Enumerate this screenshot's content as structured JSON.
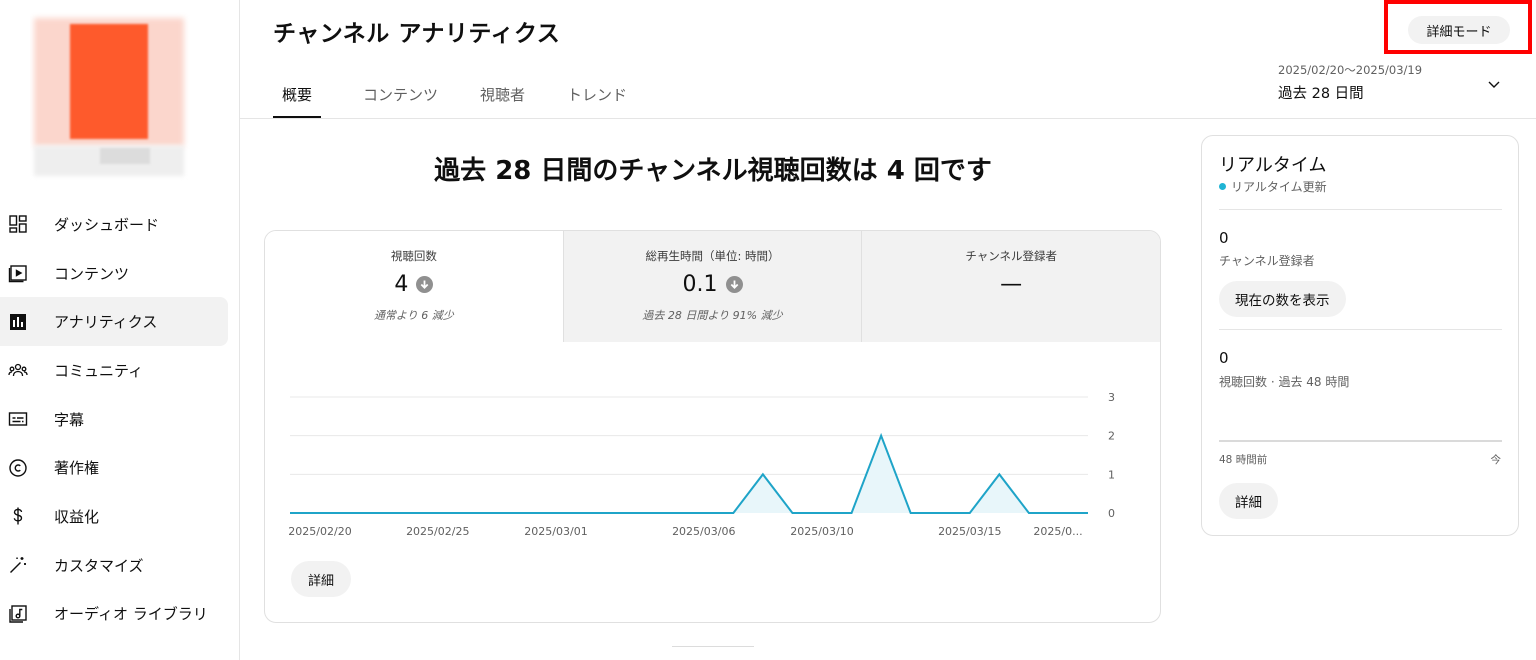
{
  "header": {
    "title": "チャンネル アナリティクス",
    "detail_mode_label": "詳細モード"
  },
  "tabs": [
    {
      "label": "概要"
    },
    {
      "label": "コンテンツ"
    },
    {
      "label": "視聴者"
    },
    {
      "label": "トレンド"
    }
  ],
  "date_range": {
    "dates": "2025/02/20〜2025/03/19",
    "label": "過去 28 日間"
  },
  "sidebar": {
    "items": [
      {
        "label": "ダッシュボード",
        "icon": "dashboard-icon"
      },
      {
        "label": "コンテンツ",
        "icon": "content-icon"
      },
      {
        "label": "アナリティクス",
        "icon": "analytics-icon",
        "active": true
      },
      {
        "label": "コミュニティ",
        "icon": "community-icon"
      },
      {
        "label": "字幕",
        "icon": "subtitles-icon"
      },
      {
        "label": "著作権",
        "icon": "copyright-icon"
      },
      {
        "label": "収益化",
        "icon": "dollar-icon"
      },
      {
        "label": "カスタマイズ",
        "icon": "magic-wand-icon"
      },
      {
        "label": "オーディオ ライブラリ",
        "icon": "audio-library-icon"
      }
    ]
  },
  "headline": "過去 28 日間のチャンネル視聴回数は 4 回です",
  "metrics": [
    {
      "title": "視聴回数",
      "value": "4",
      "note": "通常より 6 減少"
    },
    {
      "title": "総再生時間（単位: 時間）",
      "value": "0.1",
      "note": "過去 28 日間より 91% 減少"
    },
    {
      "title": "チャンネル登録者",
      "value": "—",
      "note": ""
    }
  ],
  "main_detail_label": "詳細",
  "realtime": {
    "title": "リアルタイム",
    "subtitle": "リアルタイム更新",
    "subscribers_value": "0",
    "subscribers_label": "チャンネル登録者",
    "show_count_label": "現在の数を表示",
    "views_value": "0",
    "views_label": "視聴回数 · 過去 48 時間",
    "axis_left": "48 時間前",
    "axis_right": "今",
    "detail_label": "詳細"
  },
  "colors": {
    "accent_line": "#1fa4c8",
    "accent_fill": "#e8f6fa",
    "highlight_box": "#ff0000",
    "realtime_dot": "#1fb4d4"
  },
  "chart_data": {
    "type": "area",
    "x": [
      "2025/02/20",
      "2025/02/21",
      "2025/02/22",
      "2025/02/23",
      "2025/02/24",
      "2025/02/25",
      "2025/02/26",
      "2025/02/27",
      "2025/02/28",
      "2025/03/01",
      "2025/03/02",
      "2025/03/03",
      "2025/03/04",
      "2025/03/05",
      "2025/03/06",
      "2025/03/07",
      "2025/03/08",
      "2025/03/09",
      "2025/03/10",
      "2025/03/11",
      "2025/03/12",
      "2025/03/13",
      "2025/03/14",
      "2025/03/15",
      "2025/03/16",
      "2025/03/17",
      "2025/03/18",
      "2025/03/19"
    ],
    "tick_labels": [
      "2025/02/20",
      "2025/02/25",
      "2025/03/01",
      "2025/03/06",
      "2025/03/10",
      "2025/03/15",
      "2025/03/19"
    ],
    "tick_display": [
      "2025/02/20",
      "2025/02/25",
      "2025/03/01",
      "2025/03/06",
      "2025/03/10",
      "2025/03/15",
      "2025/0..."
    ],
    "series": [
      {
        "values": [
          0,
          0,
          0,
          0,
          0,
          0,
          0,
          0,
          0,
          0,
          0,
          0,
          0,
          0,
          0,
          0,
          1,
          0,
          0,
          0,
          2,
          0,
          0,
          0,
          1,
          0,
          0,
          0
        ]
      }
    ],
    "ylim": [
      0,
      3
    ],
    "yticks": [
      0,
      1,
      2,
      3
    ],
    "grid": true,
    "y_axis_side": "right"
  }
}
